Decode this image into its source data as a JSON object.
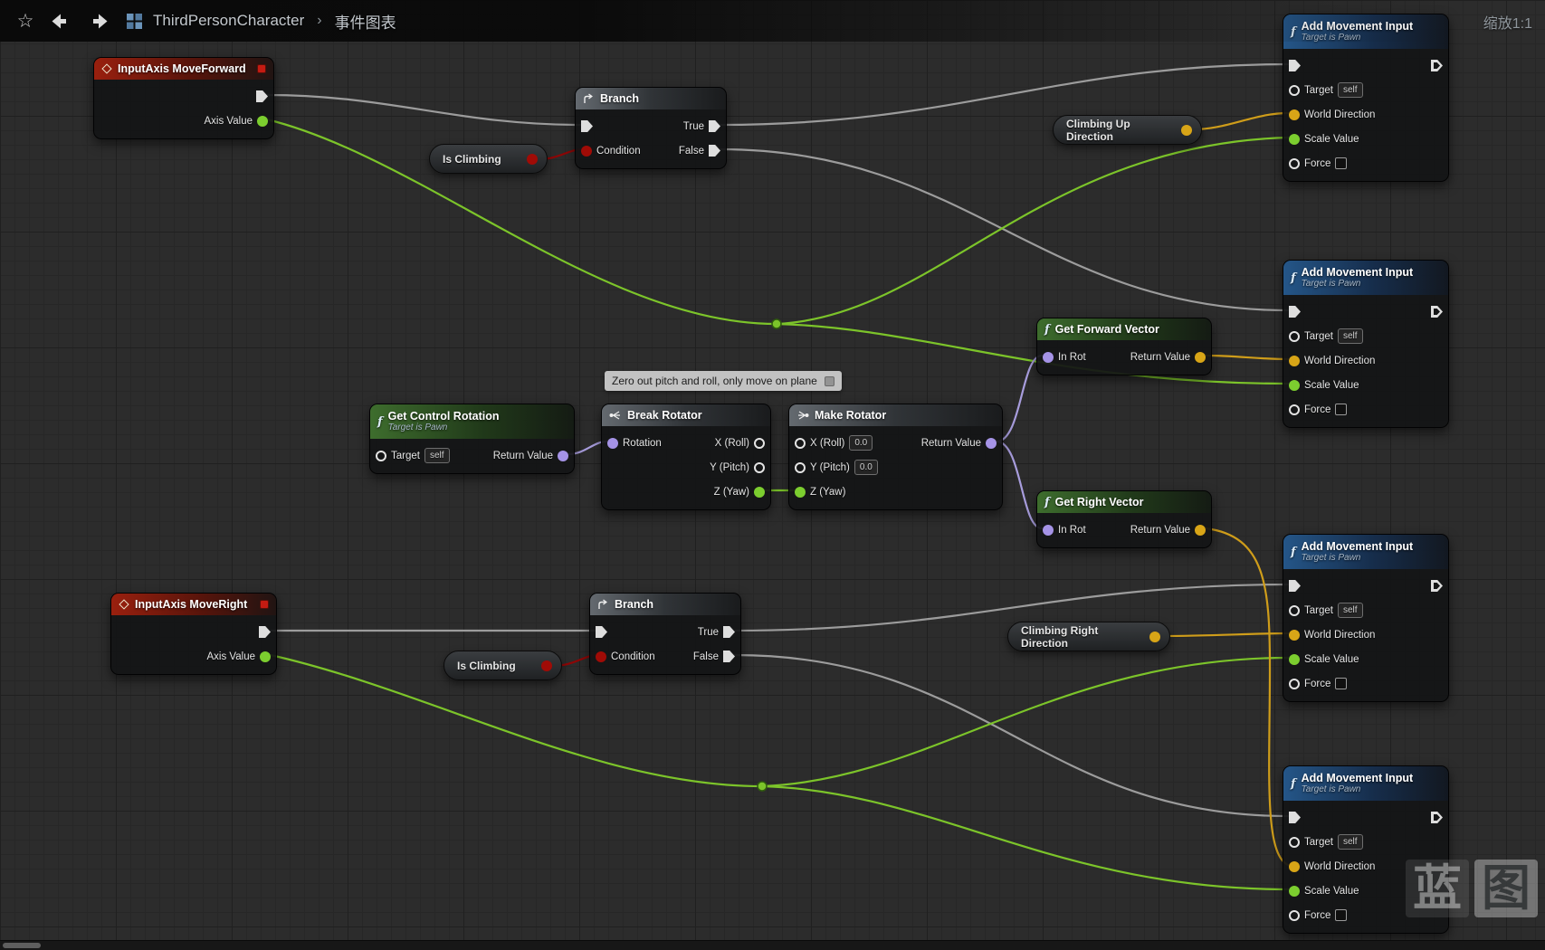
{
  "toolbar": {
    "breadcrumb_root": "ThirdPersonCharacter",
    "breadcrumb_separator": "›",
    "breadcrumb_page": "事件图表",
    "zoom_label": "缩放1:1"
  },
  "comment": {
    "text": "Zero out pitch and roll, only move on plane"
  },
  "watermark": {
    "char1": "蓝",
    "char2": "图"
  },
  "nodes": {
    "input_axis_move_forward": {
      "title": "InputAxis MoveForward"
    },
    "input_axis_move_right": {
      "title": "InputAxis MoveRight"
    },
    "branch": {
      "title": "Branch"
    },
    "is_climbing": {
      "title": "Is Climbing"
    },
    "climbing_up_direction": {
      "title": "Climbing Up Direction"
    },
    "climbing_right_direction": {
      "title": "Climbing Right Direction"
    },
    "add_movement_input": {
      "title": "Add Movement Input"
    },
    "get_forward_vector": {
      "title": "Get Forward Vector"
    },
    "get_right_vector": {
      "title": "Get Right Vector"
    },
    "get_control_rotation": {
      "title": "Get Control Rotation"
    },
    "break_rotator": {
      "title": "Break Rotator"
    },
    "make_rotator": {
      "title": "Make Rotator"
    }
  },
  "labels": {
    "axis_value": "Axis Value",
    "condition": "Condition",
    "true": "True",
    "false": "False",
    "target": "Target",
    "self": "self",
    "world_direction": "World Direction",
    "scale_value": "Scale Value",
    "force": "Force",
    "in_rot": "In Rot",
    "return_value": "Return Value",
    "rotation": "Rotation",
    "x_roll": "X (Roll)",
    "y_pitch": "Y (Pitch)",
    "z_yaw": "Z (Yaw)",
    "target_is_pawn": "Target is Pawn"
  },
  "values": {
    "zero": "0.0"
  },
  "colors": {
    "exec_wire": "#a6a6a6",
    "bool": "#a00b06",
    "float": "#7cce2f",
    "vector": "#d8a517",
    "rotator": "#a593e6",
    "object": "#1c9ce8"
  }
}
